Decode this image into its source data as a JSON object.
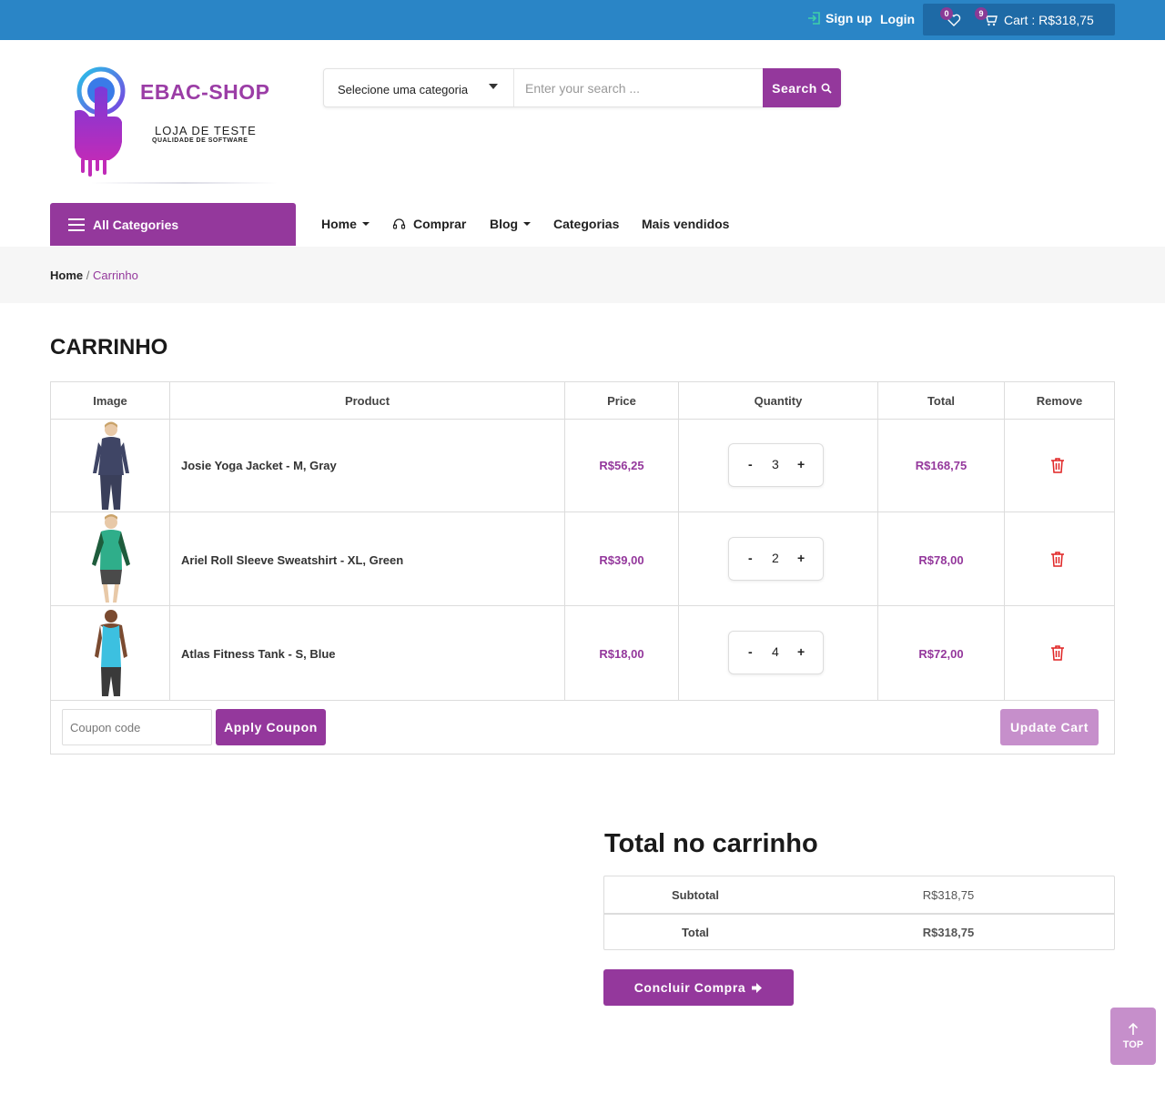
{
  "topbar": {
    "signup_label": "Sign up",
    "login_label": "Login",
    "wishlist_count": "0",
    "cart_count": "9",
    "cart_label": "Cart : R$318,75"
  },
  "logo": {
    "brand": "EBAC-SHOP",
    "tagline": "LOJA DE TESTE",
    "subtagline": "QUALIDADE DE SOFTWARE"
  },
  "search": {
    "category_selected": "Selecione uma categoria",
    "placeholder": "Enter your search ...",
    "button_label": "Search"
  },
  "nav": {
    "all_categories": "All Categories",
    "items": [
      "Home",
      "Comprar",
      "Blog",
      "Categorias",
      "Mais vendidos"
    ]
  },
  "breadcrumb": {
    "home": "Home",
    "separator": "/",
    "current": "Carrinho"
  },
  "page_title": "CARRINHO",
  "cart": {
    "headers": [
      "Image",
      "Product",
      "Price",
      "Quantity",
      "Total",
      "Remove"
    ],
    "rows": [
      {
        "product": "Josie Yoga Jacket - M, Gray",
        "price": "R$56,25",
        "quantity": "3",
        "total": "R$168,75"
      },
      {
        "product": "Ariel Roll Sleeve Sweatshirt - XL, Green",
        "price": "R$39,00",
        "quantity": "2",
        "total": "R$78,00"
      },
      {
        "product": "Atlas Fitness Tank - S, Blue",
        "price": "R$18,00",
        "quantity": "4",
        "total": "R$72,00"
      }
    ],
    "minus": "-",
    "plus": "+",
    "coupon_placeholder": "Coupon code",
    "apply_label": "Apply Coupon",
    "update_label": "Update Cart"
  },
  "totals": {
    "title": "Total no carrinho",
    "subtotal_label": "Subtotal",
    "subtotal_value": "R$318,75",
    "total_label": "Total",
    "total_value": "R$318,75",
    "checkout_label": "Concluir Compra"
  },
  "back_to_top": "TOP",
  "colors": {
    "topbar": "#2a85c6",
    "brand_purple": "#94389c",
    "light_purple": "#c68fcb",
    "remove_red": "#e02424"
  }
}
